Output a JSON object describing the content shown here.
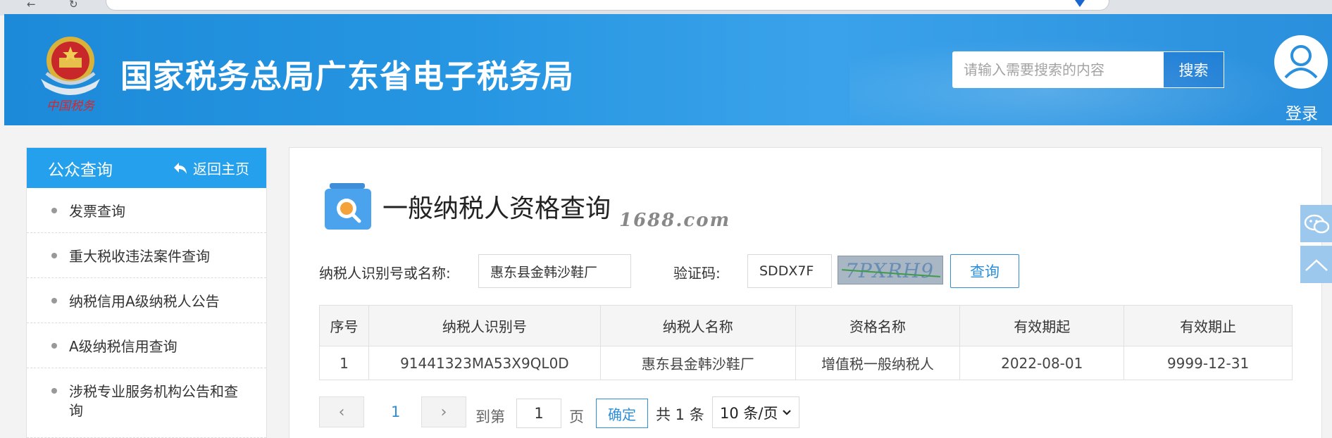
{
  "header": {
    "site_title": "国家税务总局广东省电子税务局",
    "emblem_motto": "中国税务",
    "search_placeholder": "请输入需要搜索的内容",
    "search_button": "搜索",
    "login_label": "登录"
  },
  "sidebar": {
    "title": "公众查询",
    "back_home": "返回主页",
    "items": [
      {
        "label": "发票查询"
      },
      {
        "label": "重大税收违法案件查询"
      },
      {
        "label": "纳税信用A级纳税人公告"
      },
      {
        "label": "A级纳税信用查询"
      },
      {
        "label": "涉税专业服务机构公告和查询"
      }
    ]
  },
  "main": {
    "page_title": "一般纳税人资格查询",
    "watermark": "1688.com",
    "form": {
      "taxpayer_label": "纳税人识别号或名称:",
      "taxpayer_value": "惠东县金韩沙鞋厂",
      "captcha_label": "验证码:",
      "captcha_value": "SDDX7F",
      "captcha_image_text": "7PXRH9",
      "query_button": "查询"
    },
    "table": {
      "headers": [
        "序号",
        "纳税人识别号",
        "纳税人名称",
        "资格名称",
        "有效期起",
        "有效期止"
      ],
      "rows": [
        [
          "1",
          "91441323MA53X9QL0D",
          "惠东县金韩沙鞋厂",
          "增值税一般纳税人",
          "2022-08-01",
          "9999-12-31"
        ]
      ]
    },
    "pagination": {
      "current_page": "1",
      "goto_label": "到第",
      "goto_value": "1",
      "page_unit": "页",
      "confirm_button": "确定",
      "total_text": "共 1 条",
      "page_size": "10 条/页"
    }
  },
  "colors": {
    "header_blue": "#2796e2",
    "sidebar_head": "#25a0ed",
    "accent": "#2c8fd8"
  }
}
